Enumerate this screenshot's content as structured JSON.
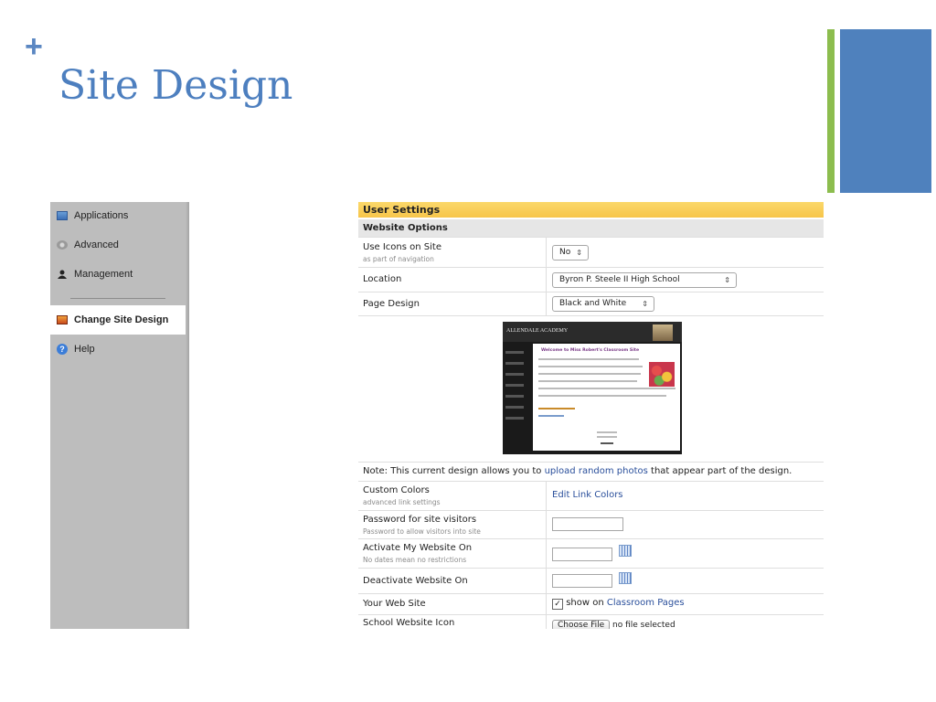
{
  "slide": {
    "plus": "+",
    "title": "Site Design"
  },
  "sidebar": {
    "items": [
      {
        "label": "Applications",
        "icon": "window-icon"
      },
      {
        "label": "Advanced",
        "icon": "gear-icon"
      },
      {
        "label": "Management",
        "icon": "user-icon"
      },
      {
        "label": "Change Site Design",
        "icon": "image-icon",
        "active": true
      },
      {
        "label": "Help",
        "icon": "help-icon"
      }
    ]
  },
  "settings": {
    "header": "User Settings",
    "section": "Website Options",
    "use_icons": {
      "label": "Use Icons on Site",
      "sub": "as part of navigation",
      "value": "No"
    },
    "location": {
      "label": "Location",
      "value": "Byron P. Steele II High School"
    },
    "page_design": {
      "label": "Page Design",
      "value": "Black and White"
    },
    "preview": {
      "brand": "ALLENDALE ACADEMY",
      "welcome": "Welcome to Miss Robert's Classroom Site"
    },
    "note": {
      "text": "Note: This current design allows you to ",
      "link": "upload random photos",
      "suffix": " that appear part of the design."
    },
    "custom_colors": {
      "label": "Custom Colors",
      "sub": "advanced link settings",
      "link": "Edit Link Colors"
    },
    "password": {
      "label": "Password for site visitors",
      "sub": "Password to allow visitors into site",
      "value": ""
    },
    "activate": {
      "label": "Activate My Website On",
      "sub": "No dates mean no restrictions",
      "value": ""
    },
    "deactivate": {
      "label": "Deactivate Website On",
      "value": ""
    },
    "web_site": {
      "label": "Your Web Site",
      "check_label": "show on ",
      "link": "Classroom Pages",
      "checked": true
    },
    "school_icon": {
      "label": "School Website Icon",
      "button": "Choose File",
      "status": "no file selected"
    }
  },
  "colors": {
    "title_blue": "#4d7fbf",
    "accent_green": "#8cbd4e",
    "accent_blue": "#4f81bd",
    "header_yellow": "#f7c54a",
    "sidebar_gray": "#bdbdbd",
    "link_blue": "#2a4f9b"
  }
}
